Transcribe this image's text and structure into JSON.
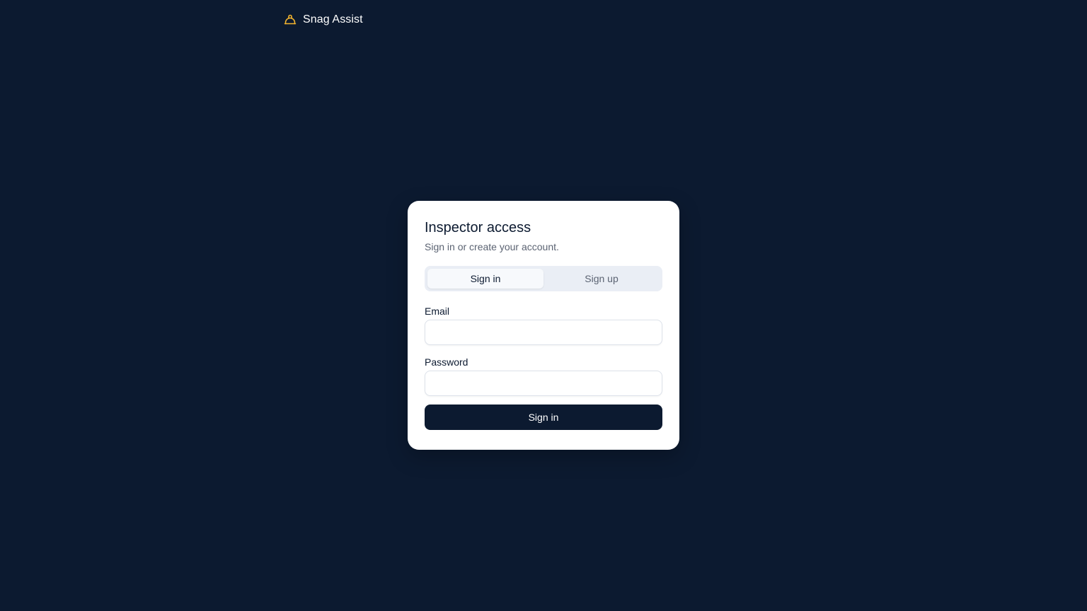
{
  "header": {
    "brand_name": "Snag Assist",
    "brand_icon": "hard-hat-icon",
    "brand_icon_color": "#f5b52e"
  },
  "auth_card": {
    "title": "Inspector access",
    "subtitle": "Sign in or create your account.",
    "tabs": [
      {
        "label": "Sign in",
        "active": true
      },
      {
        "label": "Sign up",
        "active": false
      }
    ],
    "fields": {
      "email": {
        "label": "Email",
        "value": "",
        "placeholder": ""
      },
      "password": {
        "label": "Password",
        "value": "",
        "placeholder": ""
      }
    },
    "submit_label": "Sign in"
  },
  "colors": {
    "background": "#0c1a30",
    "card": "#ffffff",
    "primary": "#0c1a30",
    "tabs_track": "#eaeef5",
    "muted_text": "#5b6372"
  }
}
